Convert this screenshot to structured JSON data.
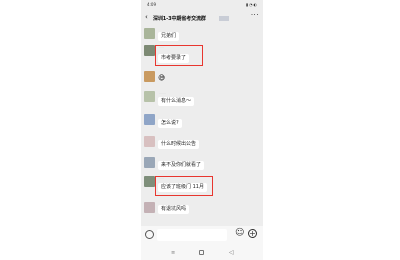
{
  "status_bar": {
    "time": "4:09",
    "icons": "▮◔◐"
  },
  "title_bar": {
    "back_glyph": "‹",
    "title": "深圳1-3中期省考交流群",
    "more_glyph": "···"
  },
  "messages": [
    {
      "name": "",
      "text": "兄弟们",
      "highlighted": false,
      "avatar_color": "#a9b59a"
    },
    {
      "name": "·····",
      "text": "市考要录了",
      "highlighted": true,
      "avatar_color": "#7d8a74"
    },
    {
      "name": "",
      "text": "",
      "highlighted": false,
      "avatar_color": "#c99a60",
      "sticker": "😅"
    },
    {
      "name": "·······",
      "text": "有什么消息～",
      "highlighted": false,
      "avatar_color": "#b7c2a9"
    },
    {
      "name": "",
      "text": "怎么说?",
      "highlighted": false,
      "avatar_color": "#8fa5c7"
    },
    {
      "name": "",
      "text": "什么时候出公告",
      "highlighted": false,
      "avatar_color": "#d8c0c0"
    },
    {
      "name": "",
      "text": "来不及你们就看了",
      "highlighted": false,
      "avatar_color": "#9aa7b7"
    },
    {
      "name": "·····",
      "text": "应该了班级门 11月",
      "highlighted": true,
      "avatar_color": "#7f8f7b"
    },
    {
      "name": "",
      "text": "有退坑风吗",
      "highlighted": false,
      "avatar_color": "#c4b1b5"
    }
  ],
  "input_bar": {
    "emoji_glyph": "☺",
    "plus_glyph": "+"
  },
  "nav_bar": {
    "menu_glyph": "≡",
    "back_glyph": "◁"
  },
  "colors": {
    "chat_background": "#ededed",
    "highlight_box": "#e8362f"
  }
}
